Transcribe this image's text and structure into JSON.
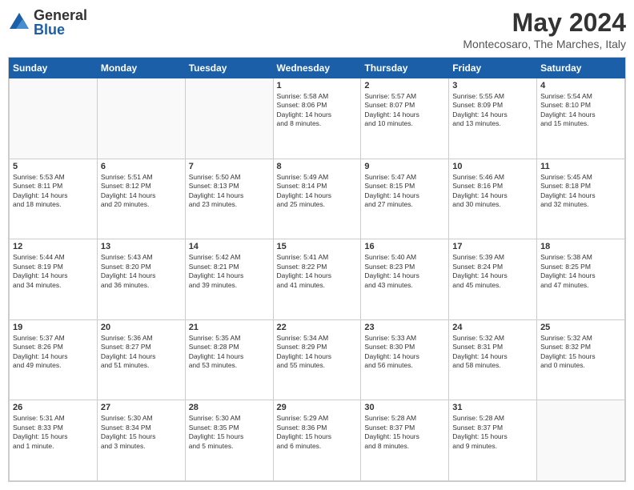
{
  "header": {
    "logo_general": "General",
    "logo_blue": "Blue",
    "title": "May 2024",
    "subtitle": "Montecosaro, The Marches, Italy"
  },
  "days_of_week": [
    "Sunday",
    "Monday",
    "Tuesday",
    "Wednesday",
    "Thursday",
    "Friday",
    "Saturday"
  ],
  "weeks": [
    [
      {
        "day": "",
        "info": ""
      },
      {
        "day": "",
        "info": ""
      },
      {
        "day": "",
        "info": ""
      },
      {
        "day": "1",
        "info": "Sunrise: 5:58 AM\nSunset: 8:06 PM\nDaylight: 14 hours\nand 8 minutes."
      },
      {
        "day": "2",
        "info": "Sunrise: 5:57 AM\nSunset: 8:07 PM\nDaylight: 14 hours\nand 10 minutes."
      },
      {
        "day": "3",
        "info": "Sunrise: 5:55 AM\nSunset: 8:09 PM\nDaylight: 14 hours\nand 13 minutes."
      },
      {
        "day": "4",
        "info": "Sunrise: 5:54 AM\nSunset: 8:10 PM\nDaylight: 14 hours\nand 15 minutes."
      }
    ],
    [
      {
        "day": "5",
        "info": "Sunrise: 5:53 AM\nSunset: 8:11 PM\nDaylight: 14 hours\nand 18 minutes."
      },
      {
        "day": "6",
        "info": "Sunrise: 5:51 AM\nSunset: 8:12 PM\nDaylight: 14 hours\nand 20 minutes."
      },
      {
        "day": "7",
        "info": "Sunrise: 5:50 AM\nSunset: 8:13 PM\nDaylight: 14 hours\nand 23 minutes."
      },
      {
        "day": "8",
        "info": "Sunrise: 5:49 AM\nSunset: 8:14 PM\nDaylight: 14 hours\nand 25 minutes."
      },
      {
        "day": "9",
        "info": "Sunrise: 5:47 AM\nSunset: 8:15 PM\nDaylight: 14 hours\nand 27 minutes."
      },
      {
        "day": "10",
        "info": "Sunrise: 5:46 AM\nSunset: 8:16 PM\nDaylight: 14 hours\nand 30 minutes."
      },
      {
        "day": "11",
        "info": "Sunrise: 5:45 AM\nSunset: 8:18 PM\nDaylight: 14 hours\nand 32 minutes."
      }
    ],
    [
      {
        "day": "12",
        "info": "Sunrise: 5:44 AM\nSunset: 8:19 PM\nDaylight: 14 hours\nand 34 minutes."
      },
      {
        "day": "13",
        "info": "Sunrise: 5:43 AM\nSunset: 8:20 PM\nDaylight: 14 hours\nand 36 minutes."
      },
      {
        "day": "14",
        "info": "Sunrise: 5:42 AM\nSunset: 8:21 PM\nDaylight: 14 hours\nand 39 minutes."
      },
      {
        "day": "15",
        "info": "Sunrise: 5:41 AM\nSunset: 8:22 PM\nDaylight: 14 hours\nand 41 minutes."
      },
      {
        "day": "16",
        "info": "Sunrise: 5:40 AM\nSunset: 8:23 PM\nDaylight: 14 hours\nand 43 minutes."
      },
      {
        "day": "17",
        "info": "Sunrise: 5:39 AM\nSunset: 8:24 PM\nDaylight: 14 hours\nand 45 minutes."
      },
      {
        "day": "18",
        "info": "Sunrise: 5:38 AM\nSunset: 8:25 PM\nDaylight: 14 hours\nand 47 minutes."
      }
    ],
    [
      {
        "day": "19",
        "info": "Sunrise: 5:37 AM\nSunset: 8:26 PM\nDaylight: 14 hours\nand 49 minutes."
      },
      {
        "day": "20",
        "info": "Sunrise: 5:36 AM\nSunset: 8:27 PM\nDaylight: 14 hours\nand 51 minutes."
      },
      {
        "day": "21",
        "info": "Sunrise: 5:35 AM\nSunset: 8:28 PM\nDaylight: 14 hours\nand 53 minutes."
      },
      {
        "day": "22",
        "info": "Sunrise: 5:34 AM\nSunset: 8:29 PM\nDaylight: 14 hours\nand 55 minutes."
      },
      {
        "day": "23",
        "info": "Sunrise: 5:33 AM\nSunset: 8:30 PM\nDaylight: 14 hours\nand 56 minutes."
      },
      {
        "day": "24",
        "info": "Sunrise: 5:32 AM\nSunset: 8:31 PM\nDaylight: 14 hours\nand 58 minutes."
      },
      {
        "day": "25",
        "info": "Sunrise: 5:32 AM\nSunset: 8:32 PM\nDaylight: 15 hours\nand 0 minutes."
      }
    ],
    [
      {
        "day": "26",
        "info": "Sunrise: 5:31 AM\nSunset: 8:33 PM\nDaylight: 15 hours\nand 1 minute."
      },
      {
        "day": "27",
        "info": "Sunrise: 5:30 AM\nSunset: 8:34 PM\nDaylight: 15 hours\nand 3 minutes."
      },
      {
        "day": "28",
        "info": "Sunrise: 5:30 AM\nSunset: 8:35 PM\nDaylight: 15 hours\nand 5 minutes."
      },
      {
        "day": "29",
        "info": "Sunrise: 5:29 AM\nSunset: 8:36 PM\nDaylight: 15 hours\nand 6 minutes."
      },
      {
        "day": "30",
        "info": "Sunrise: 5:28 AM\nSunset: 8:37 PM\nDaylight: 15 hours\nand 8 minutes."
      },
      {
        "day": "31",
        "info": "Sunrise: 5:28 AM\nSunset: 8:37 PM\nDaylight: 15 hours\nand 9 minutes."
      },
      {
        "day": "",
        "info": ""
      }
    ]
  ]
}
